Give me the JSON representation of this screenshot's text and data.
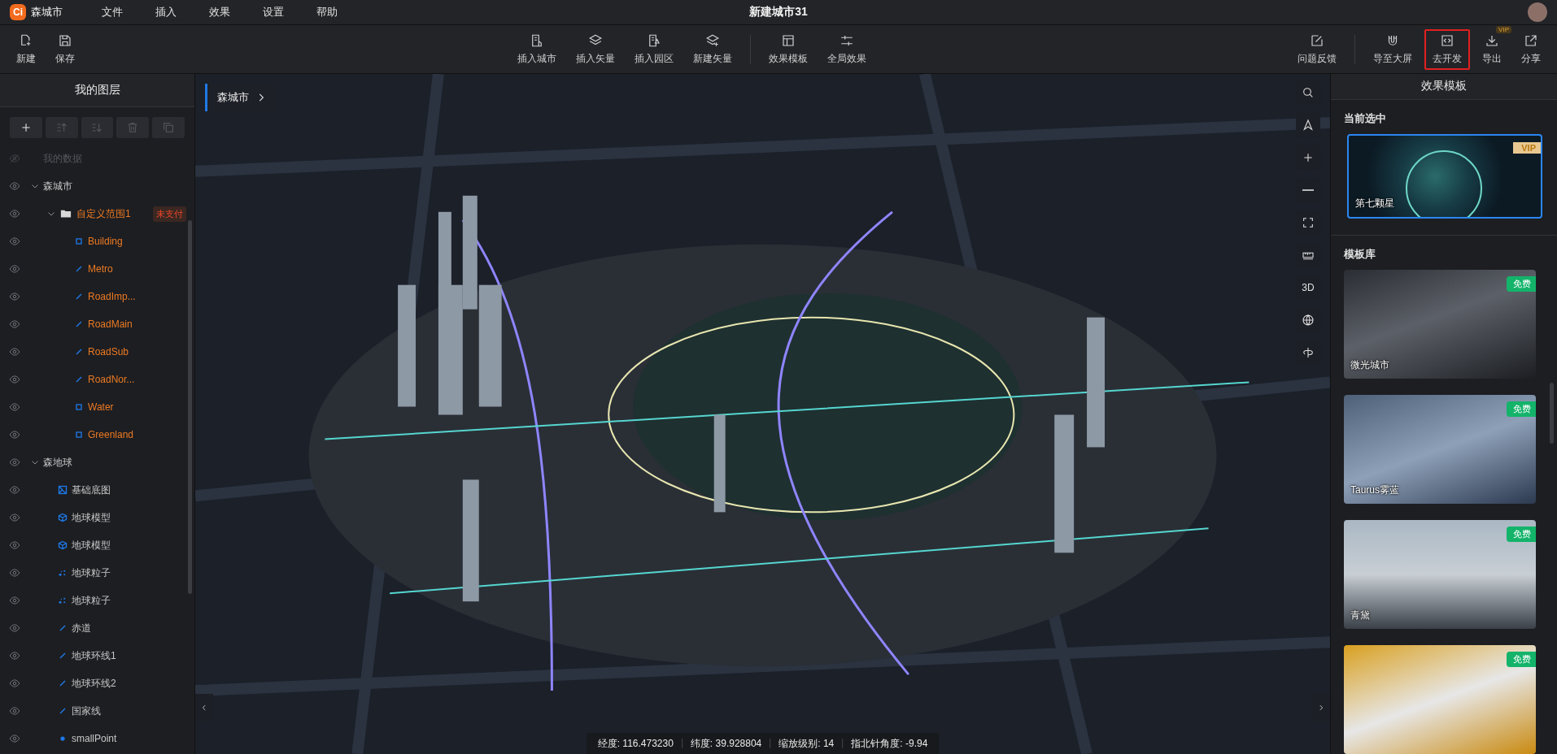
{
  "app": {
    "logo": "Ci",
    "name": "森城市",
    "title": "新建城市31"
  },
  "menu": [
    "文件",
    "插入",
    "效果",
    "设置",
    "帮助"
  ],
  "toolbar": {
    "groups": [
      [
        {
          "label": "新建"
        },
        {
          "label": "保存"
        }
      ],
      [
        {
          "label": "插入城市"
        },
        {
          "label": "插入矢量"
        },
        {
          "label": "插入园区"
        },
        {
          "label": "新建矢量"
        }
      ],
      [
        {
          "label": "效果模板"
        },
        {
          "label": "全局效果"
        }
      ],
      [
        {
          "label": "问题反馈"
        }
      ],
      [
        {
          "label": "导至大屏",
          "highlighted": false
        },
        {
          "label": "去开发",
          "highlighted": true
        },
        {
          "label": "导出",
          "badge": "VIP",
          "highlighted": false
        },
        {
          "label": "分享",
          "highlighted": false
        }
      ]
    ]
  },
  "layers_panel": {
    "title": "我的图层",
    "layers": [
      {
        "label": "我的数据",
        "visible": false
      },
      {
        "label": "森城市",
        "visible": true,
        "expanded": true,
        "children": [
          {
            "label": "自定义范围1",
            "kind": "folder",
            "visible": true,
            "expanded": true,
            "alert": true,
            "badge": "未支付",
            "children": [
              {
                "label": "Building",
                "kind": "polygon",
                "visible": true,
                "alert": true
              },
              {
                "label": "Metro",
                "kind": "line",
                "visible": true,
                "alert": true
              },
              {
                "label": "RoadImp...",
                "kind": "line",
                "visible": true,
                "alert": true
              },
              {
                "label": "RoadMain",
                "kind": "line",
                "visible": true,
                "alert": true
              },
              {
                "label": "RoadSub",
                "kind": "line",
                "visible": true,
                "alert": true
              },
              {
                "label": "RoadNor...",
                "kind": "line",
                "visible": true,
                "alert": true
              },
              {
                "label": "Water",
                "kind": "polygon",
                "visible": true,
                "alert": true
              },
              {
                "label": "Greenland",
                "kind": "polygon",
                "visible": true,
                "alert": true
              }
            ]
          }
        ]
      },
      {
        "label": "森地球",
        "visible": true,
        "expanded": true,
        "children": [
          {
            "label": "基础底图",
            "kind": "basemap",
            "visible": true,
            "alert": false
          },
          {
            "label": "地球模型",
            "kind": "model",
            "visible": true,
            "alert": false
          },
          {
            "label": "地球模型",
            "kind": "model",
            "visible": true,
            "alert": false
          },
          {
            "label": "地球粒子",
            "kind": "particles",
            "visible": true,
            "alert": false
          },
          {
            "label": "地球粒子",
            "kind": "particles",
            "visible": true,
            "alert": false
          },
          {
            "label": "赤道",
            "kind": "line",
            "visible": true,
            "alert": false
          },
          {
            "label": "地球环线1",
            "kind": "line",
            "visible": true,
            "alert": false
          },
          {
            "label": "地球环线2",
            "kind": "line",
            "visible": true,
            "alert": false
          },
          {
            "label": "国家线",
            "kind": "line",
            "visible": true,
            "alert": false
          },
          {
            "label": "smallPoint",
            "kind": "point",
            "visible": true,
            "alert": false
          }
        ]
      }
    ]
  },
  "map": {
    "breadcrumb": "森城市",
    "controls": [
      {
        "kind": "icon"
      },
      {
        "kind": "icon"
      },
      {
        "kind": "icon"
      },
      {
        "kind": "icon"
      },
      {
        "kind": "icon"
      },
      {
        "kind": "icon"
      },
      {
        "kind": "text",
        "label": "3D"
      },
      {
        "kind": "icon"
      },
      {
        "kind": "icon"
      }
    ],
    "status": [
      "经度: 116.473230",
      "纬度: 39.928804",
      "缩放级别: 14",
      "指北针角度: -9.94"
    ]
  },
  "templates_panel": {
    "title": "效果模板",
    "current_heading": "当前选中",
    "current": {
      "name": "第七颗星",
      "badge": "VIP",
      "selected": true
    },
    "library_heading": "模板库",
    "library": [
      {
        "name": "微光城市",
        "badge": "免费"
      },
      {
        "name": "Taurus雾蓝",
        "badge": "免费"
      },
      {
        "name": "青黛",
        "badge": "免费"
      },
      {
        "badge": "免费"
      }
    ]
  }
}
